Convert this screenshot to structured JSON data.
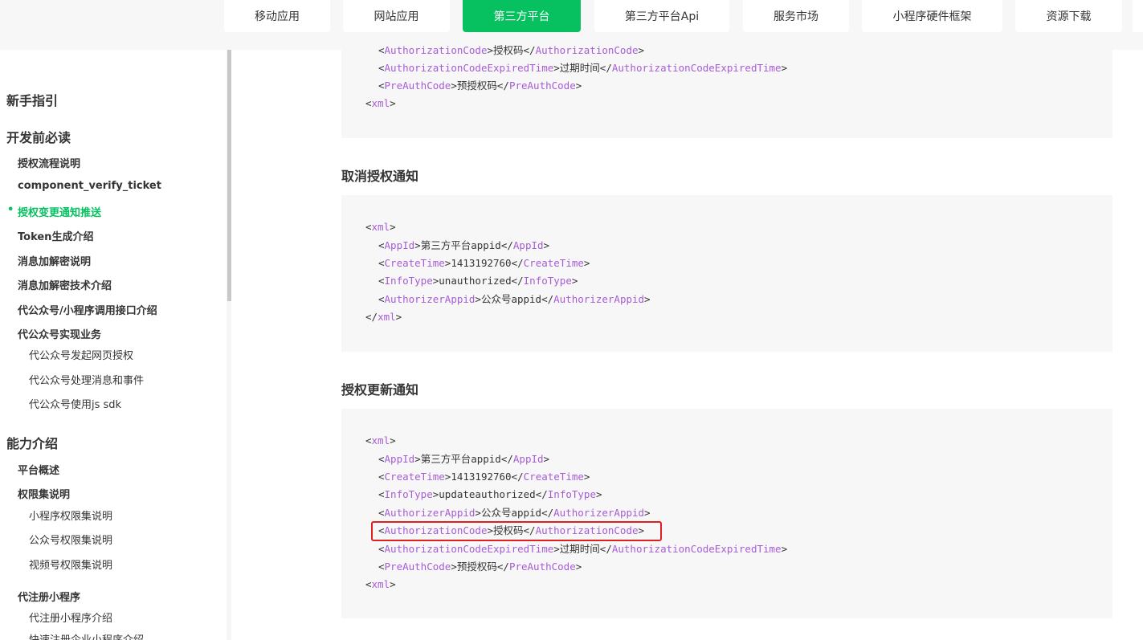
{
  "nav": {
    "tabs": [
      {
        "label": "移动应用",
        "active": false
      },
      {
        "label": "网站应用",
        "active": false
      },
      {
        "label": "第三方平台",
        "active": true
      },
      {
        "label": "第三方平台Api",
        "active": false
      },
      {
        "label": "服务市场",
        "active": false
      },
      {
        "label": "小程序硬件框架",
        "active": false
      },
      {
        "label": "资源下载",
        "active": false
      }
    ]
  },
  "sidebar": {
    "items": [
      {
        "label": "新手指引"
      },
      {
        "label": "开发前必读"
      },
      {
        "label": "授权流程说明"
      },
      {
        "label": "component_verify_ticket"
      },
      {
        "label": "授权变更通知推送"
      },
      {
        "label": "Token生成介绍"
      },
      {
        "label": "消息加解密说明"
      },
      {
        "label": "消息加解密技术介绍"
      },
      {
        "label": "代公众号/小程序调用接口介绍"
      },
      {
        "label": "代公众号实现业务"
      },
      {
        "label": "代公众号发起网页授权"
      },
      {
        "label": "代公众号处理消息和事件"
      },
      {
        "label": "代公众号使用js sdk"
      },
      {
        "label": "能力介绍"
      },
      {
        "label": "平台概述"
      },
      {
        "label": "权限集说明"
      },
      {
        "label": "小程序权限集说明"
      },
      {
        "label": "公众号权限集说明"
      },
      {
        "label": "视频号权限集说明"
      },
      {
        "label": "代注册小程序"
      },
      {
        "label": "代注册小程序介绍"
      },
      {
        "label": "快速注册企业小程序介绍"
      }
    ]
  },
  "sections": {
    "cancel_title": "取消授权通知",
    "update_title": "授权更新通知"
  },
  "code_top": {
    "auth_code_tag": "AuthorizationCode",
    "auth_code_val": "授权码",
    "expired_tag": "AuthorizationCodeExpiredTime",
    "expired_val": "过期时间",
    "preauth_tag": "PreAuthCode",
    "preauth_val": "预授权码",
    "xml": "xml"
  },
  "code_cancel": {
    "xml": "xml",
    "appid_tag": "AppId",
    "appid_val": "第三方平台appid",
    "createtime_tag": "CreateTime",
    "createtime_val": "1413192760",
    "infotype_tag": "InfoType",
    "infotype_val": "unauthorized",
    "authorizer_tag": "AuthorizerAppid",
    "authorizer_val": "公众号appid"
  },
  "code_update": {
    "xml": "xml",
    "appid_tag": "AppId",
    "appid_val": "第三方平台appid",
    "createtime_tag": "CreateTime",
    "createtime_val": "1413192760",
    "infotype_tag": "InfoType",
    "infotype_val": "updateauthorized",
    "authorizer_tag": "AuthorizerAppid",
    "authorizer_val": "公众号appid",
    "auth_code_tag": "AuthorizationCode",
    "auth_code_val": "授权码",
    "expired_tag": "AuthorizationCodeExpiredTime",
    "expired_val": "过期时间",
    "preauth_tag": "PreAuthCode",
    "preauth_val": "预授权码"
  },
  "colors": {
    "accent": "#07c160",
    "tag": "#a75cd6",
    "highlight": "#e02020"
  }
}
